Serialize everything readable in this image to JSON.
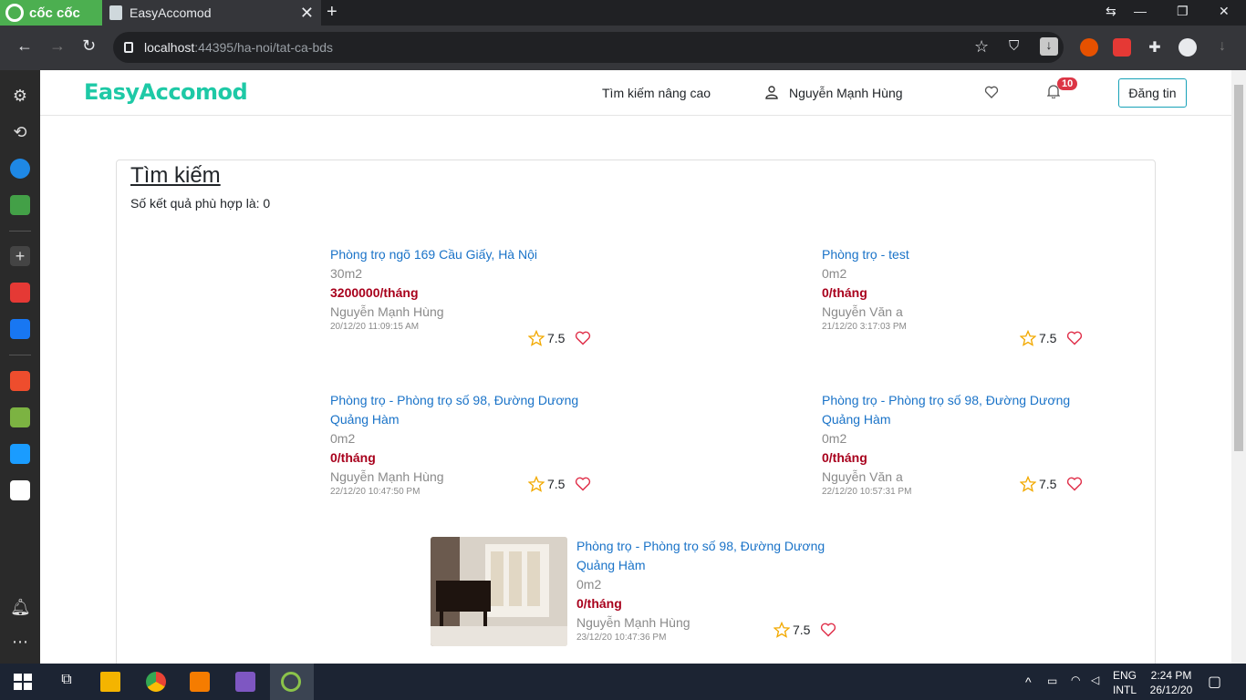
{
  "browser": {
    "brand": "cốc cốc",
    "tab_title": "EasyAccomod",
    "url_host": "localhost",
    "url_rest": ":44395/ha-noi/tat-ca-bds"
  },
  "header": {
    "brand": "EasyAccomod",
    "advanced_search": "Tìm kiếm nâng cao",
    "user_name": "Nguyễn Mạnh Hùng",
    "notification_count": "10",
    "post_button": "Đăng tin"
  },
  "search": {
    "title": "Tìm kiếm",
    "result_count": "Số kết quả phù hợp là: 0"
  },
  "listings": [
    {
      "title": "Phòng trọ ngõ 169 Cầu Giấy, Hà Nội",
      "area": "30m2",
      "price": "3200000/tháng",
      "owner": "Nguyễn Mạnh Hùng",
      "date": "20/12/20 11:09:15 AM",
      "rating": "7.5"
    },
    {
      "title": "Phòng trọ - test",
      "area": "0m2",
      "price": "0/tháng",
      "owner": "Nguyễn Văn a",
      "date": "21/12/20 3:17:03 PM",
      "rating": "7.5"
    },
    {
      "title": "Phòng trọ - Phòng trọ số 98, Đường Dương Quảng Hàm",
      "area": "0m2",
      "price": "0/tháng",
      "owner": "Nguyễn Mạnh Hùng",
      "date": "22/12/20 10:47:50 PM",
      "rating": "7.5"
    },
    {
      "title": "Phòng trọ - Phòng trọ số 98, Đường Dương Quảng Hàm",
      "area": "0m2",
      "price": "0/tháng",
      "owner": "Nguyễn Văn a",
      "date": "22/12/20 10:57:31 PM",
      "rating": "7.5"
    },
    {
      "title": "Phòng trọ - Phòng trọ số 98, Đường Dương Quảng Hàm",
      "area": "0m2",
      "price": "0/tháng",
      "owner": "Nguyễn Mạnh Hùng",
      "date": "23/12/20 10:47:36 PM",
      "rating": "7.5"
    }
  ],
  "taskbar": {
    "lang1": "ENG",
    "lang2": "INTL",
    "time": "2:24 PM",
    "date": "26/12/20"
  },
  "colors": {
    "brand": "#1ec9a6",
    "link": "#1a73c8",
    "price": "#a8001c",
    "badge": "#dc3545"
  }
}
